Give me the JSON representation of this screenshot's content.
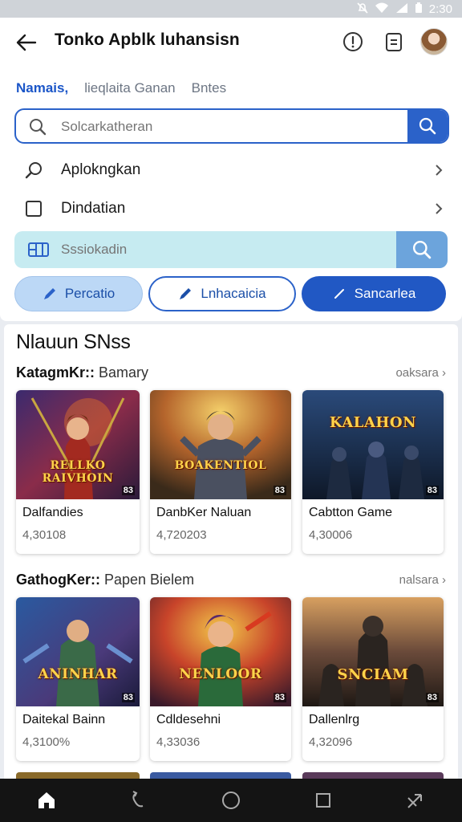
{
  "status_bar": {
    "time": "2:30",
    "icons": [
      "notification-icon",
      "wifi-icon",
      "signal-icon",
      "battery-icon"
    ]
  },
  "app_bar": {
    "title": "Tonko Apblk luhansisn"
  },
  "tabs": [
    {
      "label": "Namais,",
      "active": true
    },
    {
      "label": "lieqlaita Ganan",
      "active": false
    },
    {
      "label": "Bntes",
      "active": false
    }
  ],
  "search": {
    "placeholder": "Solcarkatheran"
  },
  "menu": [
    {
      "label": "Aplokngkan",
      "icon": "search-icon"
    },
    {
      "label": "Dindatian",
      "icon": "checkbox-icon"
    }
  ],
  "search2": {
    "placeholder": "Sssiokadin"
  },
  "chips": [
    {
      "label": "Percatio",
      "icon": "pencil-icon",
      "style": "soft"
    },
    {
      "label": "Lnhacaicia",
      "icon": "pencil-icon",
      "style": "outline"
    },
    {
      "label": "Sancarlea",
      "icon": "slash-icon",
      "style": "filled"
    }
  ],
  "section": {
    "title": "Nlauun SNss"
  },
  "categories": [
    {
      "name": "KatagmKr::",
      "sub": " Bamary",
      "see_all": "oaksara",
      "items": [
        {
          "title": "Dalfandies",
          "meta": "4,30108",
          "art_text": "RELLKO RAIVHOIN",
          "badge": "83"
        },
        {
          "title": "DanbKer Naluan",
          "meta": "4,720203",
          "art_text": "BOAKENTIOL",
          "badge": "83"
        },
        {
          "title": "Cabtton Game",
          "meta": "4,30006",
          "art_text": "KALAHON",
          "badge": "83"
        }
      ]
    },
    {
      "name": "GathogKer::",
      "sub": " Papen Bielem",
      "see_all": "nalsara",
      "items": [
        {
          "title": "Daitekal Bainn",
          "meta": "4,3100%",
          "art_text": "ANINHAR",
          "badge": "83"
        },
        {
          "title": "Cdldesehni",
          "meta": "4,33036",
          "art_text": "NENLOOR",
          "badge": "83"
        },
        {
          "title": "Dallenlrg",
          "meta": "4,32096",
          "art_text": "SNCIAM",
          "badge": "83"
        }
      ]
    }
  ],
  "nav": [
    "home-icon",
    "back-icon",
    "circle-home-icon",
    "recents-icon",
    "share-icon"
  ],
  "colors": {
    "accent": "#2b62c9",
    "search2_bg": "#c6ebf1",
    "nav_bg": "#141414"
  }
}
